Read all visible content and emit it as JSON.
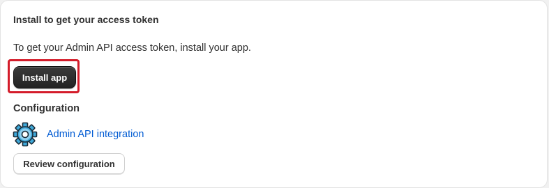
{
  "section": {
    "title": "Install to get your access token",
    "description": "To get your Admin API access token, install your app.",
    "install_button_label": "Install app"
  },
  "configuration": {
    "heading": "Configuration",
    "integration_link_label": "Admin API integration",
    "integration_icon": "gear-icon",
    "review_button_label": "Review configuration"
  },
  "colors": {
    "link": "#005bd3",
    "primary_button": "#303030",
    "highlight_outline": "#d41c2a"
  }
}
